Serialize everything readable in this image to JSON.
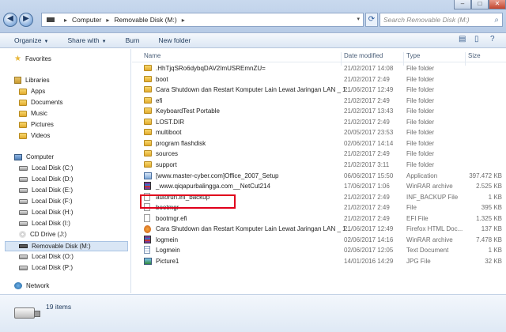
{
  "window": {
    "title_faint": "",
    "address": [
      "Computer",
      "Removable Disk (M:)"
    ],
    "search_placeholder": "Search Removable Disk (M:)"
  },
  "toolbar": {
    "organize": "Organize",
    "share_with": "Share with",
    "burn": "Burn",
    "new_folder": "New folder"
  },
  "nav": {
    "favorites": "Favorites",
    "libraries": "Libraries",
    "library_items": [
      "Apps",
      "Documents",
      "Music",
      "Pictures",
      "Videos"
    ],
    "computer": "Computer",
    "drives": [
      "Local Disk (C:)",
      "Local Disk (D:)",
      "Local Disk (E:)",
      "Local Disk (F:)",
      "Local Disk (H:)",
      "Local Disk (I:)",
      "CD Drive (J:)",
      "Removable Disk (M:)",
      "Local Disk (O:)",
      "Local Disk (P:)"
    ],
    "network": "Network"
  },
  "columns": {
    "name": "Name",
    "date": "Date modified",
    "type": "Type",
    "size": "Size"
  },
  "files": [
    {
      "name": ".HhTjqSRo6dybqDAV2ImUSREmnZU=",
      "date": "21/02/2017 14:08",
      "type": "File folder",
      "size": "",
      "icon": "folder"
    },
    {
      "name": "boot",
      "date": "21/02/2017 2:49",
      "type": "File folder",
      "size": "",
      "icon": "folder"
    },
    {
      "name": "Cara Shutdown dan Restart Komputer Lain Lewat Jaringan LAN _ 1...",
      "date": "21/06/2017 12:49",
      "type": "File folder",
      "size": "",
      "icon": "folder"
    },
    {
      "name": "efi",
      "date": "21/02/2017 2:49",
      "type": "File folder",
      "size": "",
      "icon": "folder"
    },
    {
      "name": "KeyboardTest Portable",
      "date": "21/02/2017 13:43",
      "type": "File folder",
      "size": "",
      "icon": "folder"
    },
    {
      "name": "LOST.DIR",
      "date": "21/02/2017 2:49",
      "type": "File folder",
      "size": "",
      "icon": "folder"
    },
    {
      "name": "multiboot",
      "date": "20/05/2017 23:53",
      "type": "File folder",
      "size": "",
      "icon": "folder"
    },
    {
      "name": "program flashdisk",
      "date": "02/06/2017 14:14",
      "type": "File folder",
      "size": "",
      "icon": "folder"
    },
    {
      "name": "sources",
      "date": "21/02/2017 2:49",
      "type": "File folder",
      "size": "",
      "icon": "folder"
    },
    {
      "name": "support",
      "date": "21/02/2017 3:11",
      "type": "File folder",
      "size": "",
      "icon": "folder"
    },
    {
      "name": "[www.master-cyber.com]Office_2007_Setup",
      "date": "06/06/2017 15:50",
      "type": "Application",
      "size": "397.472 KB",
      "icon": "app"
    },
    {
      "name": "_www.qiqapurbalingga.com__NetCut214",
      "date": "17/06/2017 1:06",
      "type": "WinRAR archive",
      "size": "2.525 KB",
      "icon": "rar"
    },
    {
      "name": "autorun.inf_backup",
      "date": "21/02/2017 2:49",
      "type": "INF_BACKUP File",
      "size": "1 KB",
      "icon": "file"
    },
    {
      "name": "bootmgr",
      "date": "21/02/2017 2:49",
      "type": "File",
      "size": "395 KB",
      "icon": "file"
    },
    {
      "name": "bootmgr.efi",
      "date": "21/02/2017 2:49",
      "type": "EFI File",
      "size": "1.325 KB",
      "icon": "file"
    },
    {
      "name": "Cara Shutdown dan Restart Komputer Lain Lewat Jaringan LAN _ 1...",
      "date": "21/06/2017 12:49",
      "type": "Firefox HTML Doc...",
      "size": "137 KB",
      "icon": "html"
    },
    {
      "name": "logmein",
      "date": "02/06/2017 14:16",
      "type": "WinRAR archive",
      "size": "7.478 KB",
      "icon": "rar"
    },
    {
      "name": "Logmein",
      "date": "02/06/2017 12:05",
      "type": "Text Document",
      "size": "1 KB",
      "icon": "txt"
    },
    {
      "name": "Picture1",
      "date": "14/01/2016 14:29",
      "type": "JPG File",
      "size": "32 KB",
      "icon": "jpg"
    }
  ],
  "status": {
    "count": "19 items"
  }
}
